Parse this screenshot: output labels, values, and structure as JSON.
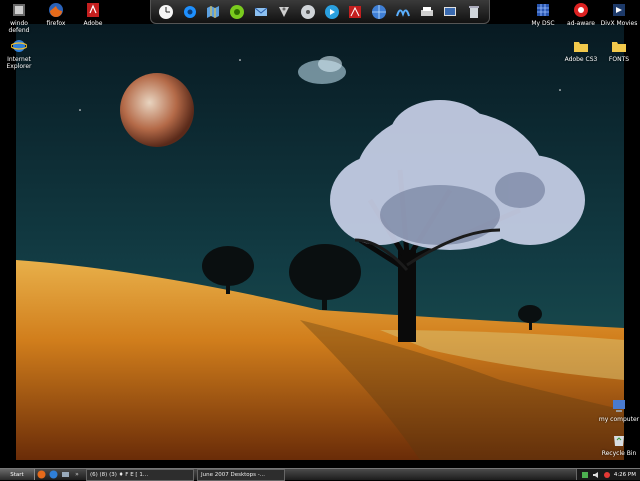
{
  "desktop": {
    "icons_left": [
      {
        "label": "windo\ndefend",
        "icon": "windows-defender-icon"
      },
      {
        "label": "firefox",
        "icon": "firefox-icon"
      },
      {
        "label": "Adobe",
        "icon": "adobe-reader-icon"
      },
      {
        "label": "Internet\nExplorer",
        "icon": "internet-explorer-icon"
      }
    ],
    "icons_right": [
      {
        "label": "My DSC",
        "icon": "grid-app-icon"
      },
      {
        "label": "ad-aware",
        "icon": "ad-aware-icon"
      },
      {
        "label": "DivX Movies",
        "icon": "divx-icon"
      },
      {
        "label": "Adobe CS3",
        "icon": "folder-icon"
      },
      {
        "label": "FONTS",
        "icon": "folder-icon"
      }
    ],
    "icons_bottom_right": [
      {
        "label": "my computer",
        "icon": "my-computer-icon"
      },
      {
        "label": "Recycle Bin",
        "icon": "recycle-bin-icon"
      }
    ]
  },
  "dock": {
    "items": [
      "clock-icon",
      "gear-icon",
      "map-icon",
      "green-gear-icon",
      "mail-icon",
      "wifi-icon",
      "cd-icon",
      "media-player-icon",
      "acrobat-icon",
      "globe-icon",
      "wave-icon",
      "printer-icon",
      "monitor-icon",
      "trash-icon"
    ]
  },
  "taskbar": {
    "start_label": "Start",
    "tasks": [
      {
        "label": "(6) (8) (3) ♦ F E [ 1..."
      },
      {
        "label": "June 2007 Desktops -..."
      }
    ],
    "clock": "4:26 PM"
  },
  "colors": {
    "sky": "#0d2a33",
    "field": "#c9771a",
    "taskbar": "#2a2a2a"
  }
}
